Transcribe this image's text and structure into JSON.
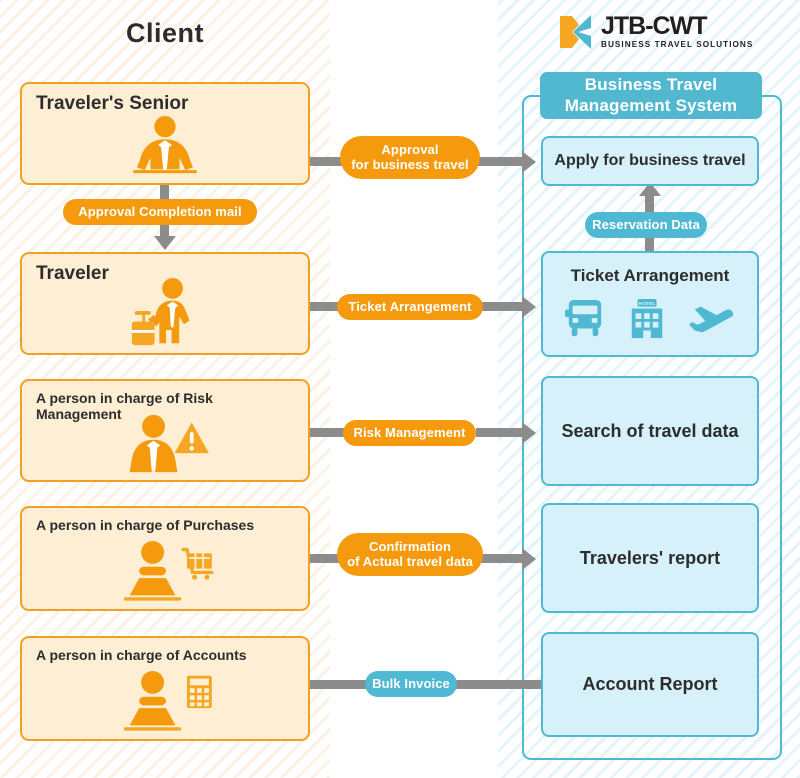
{
  "diagram": {
    "client_title": "Client",
    "logo": {
      "name": "JTB-CWT",
      "tagline": "BUSINESS TRAVEL SOLUTIONS",
      "mark_orange": "#f5a623",
      "mark_teal": "#4fb9d4"
    },
    "system_header": "Business Travel\nManagement System",
    "colors": {
      "orange_accent": "#f0a125",
      "orange_fill": "#fdeed4",
      "orange_pill": "#f59a0d",
      "blue_accent": "#4fb9d4",
      "blue_fill": "#d7f1fa",
      "blue_header": "#52b8d0",
      "connector_gray": "#8c8c8c",
      "text_dark": "#2d2d2d"
    },
    "client_boxes": [
      {
        "label": "Traveler's Senior",
        "icon": "manager-icon",
        "font_size": "19px"
      },
      {
        "label": "Traveler",
        "icon": "traveler-suitcase-icon",
        "font_size": "19px"
      },
      {
        "label": "A person in charge of Risk Management",
        "icon": "person-warning-icon",
        "font_size": "14px"
      },
      {
        "label": "A person in charge of Purchases",
        "icon": "person-cart-icon",
        "font_size": "14px"
      },
      {
        "label": "A person in charge of Accounts",
        "icon": "person-calculator-icon",
        "font_size": "14px"
      }
    ],
    "system_boxes": [
      {
        "title": "Apply for business travel",
        "font_size": "16px",
        "icons": []
      },
      {
        "title": "Ticket Arrangement",
        "font_size": "17px",
        "icons": [
          "bus-icon",
          "hotel-icon",
          "airplane-icon"
        ]
      },
      {
        "title": "Search of travel data",
        "font_size": "18px",
        "icons": []
      },
      {
        "title": "Travelers' report",
        "font_size": "18px",
        "icons": []
      },
      {
        "title": "Account Report",
        "font_size": "18px",
        "icons": []
      }
    ],
    "flow_labels": [
      {
        "text": "Approval\nfor business travel",
        "color": "orange",
        "font_size": "13px"
      },
      {
        "text": "Approval Completion mail",
        "color": "orange",
        "font_size": "13px"
      },
      {
        "text": "Reservation Data",
        "color": "blue",
        "font_size": "13px"
      },
      {
        "text": "Ticket Arrangement",
        "color": "orange",
        "font_size": "13px"
      },
      {
        "text": "Risk Management",
        "color": "orange",
        "font_size": "13px"
      },
      {
        "text": "Confirmation\nof Actual travel data",
        "color": "orange",
        "font_size": "13px"
      },
      {
        "text": "Bulk Invoice",
        "color": "blue",
        "font_size": "13px"
      }
    ]
  }
}
